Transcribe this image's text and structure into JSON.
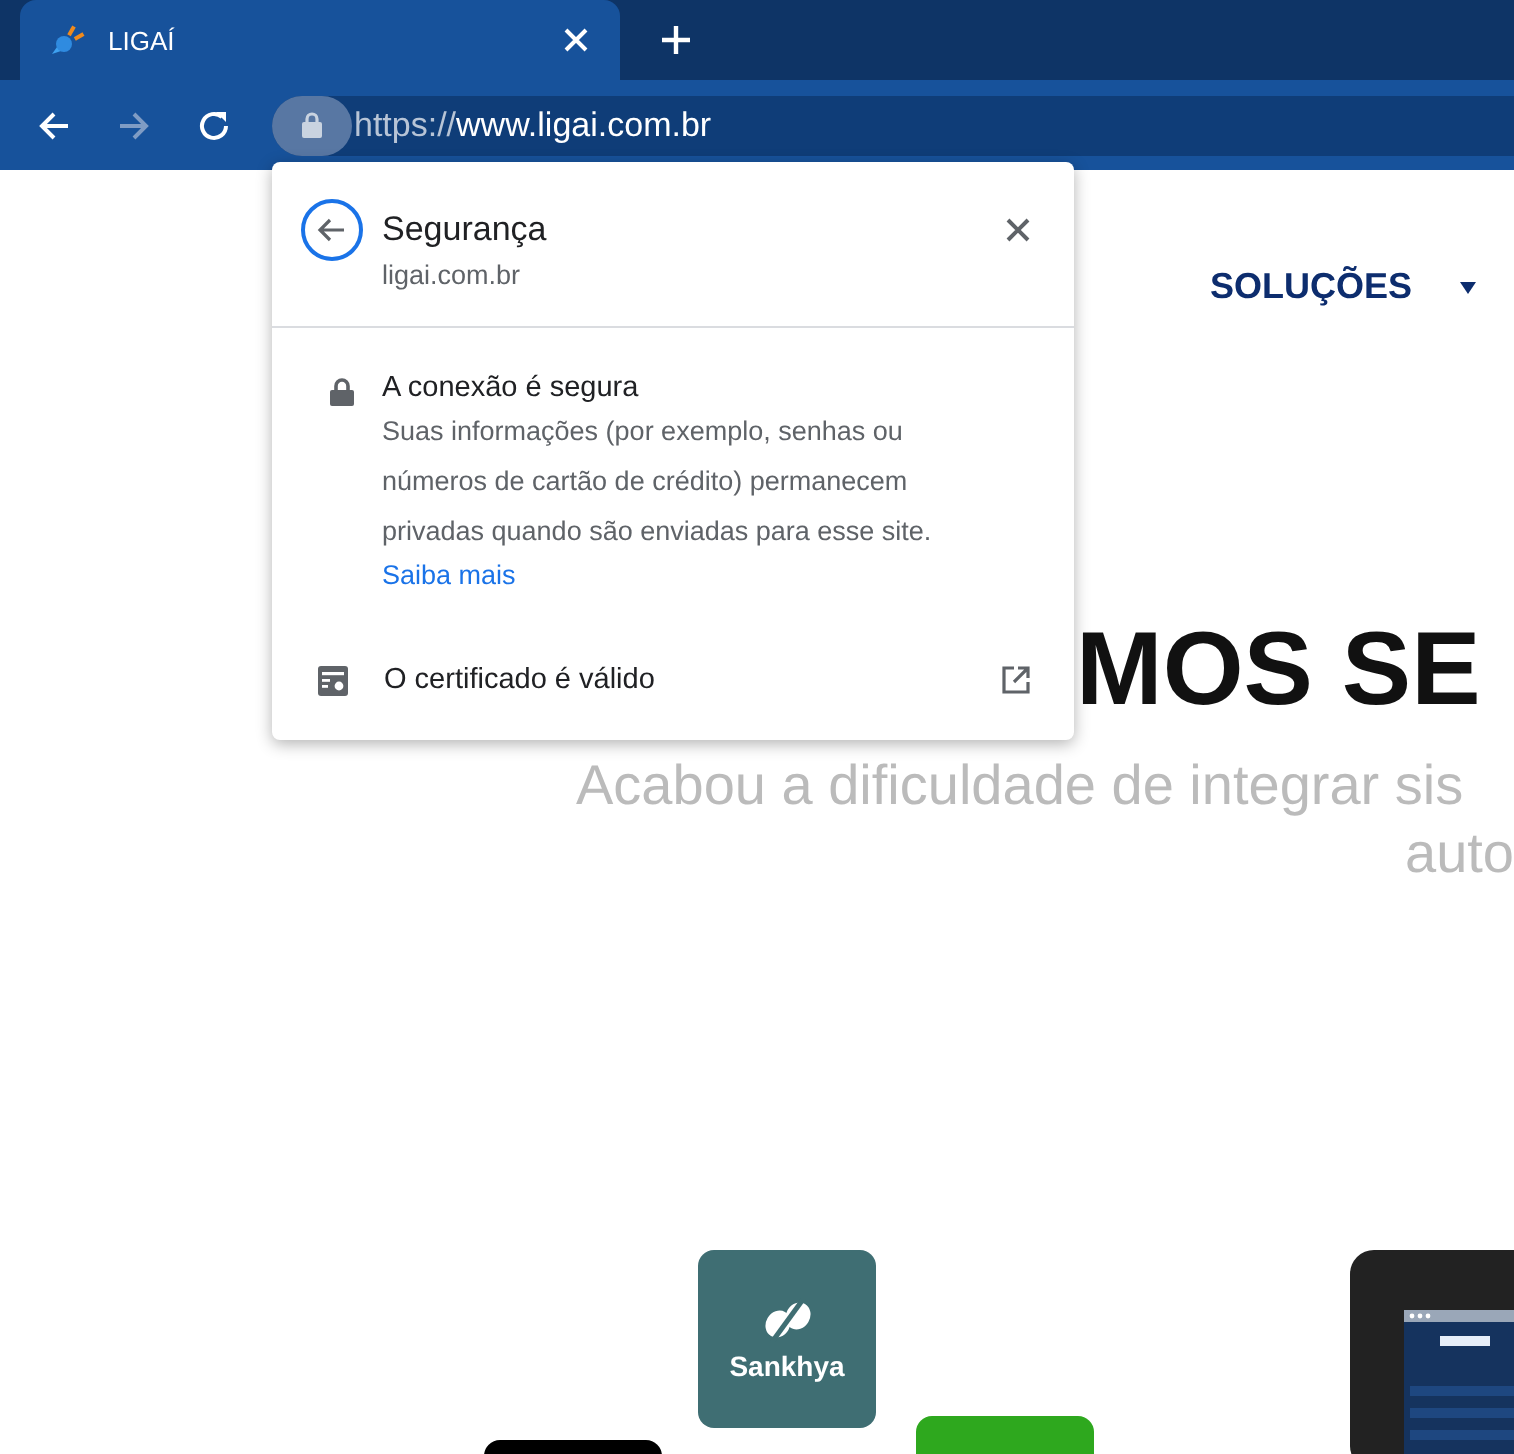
{
  "browser": {
    "tabs": [
      {
        "title": "LIGAÍ",
        "selected": true
      }
    ],
    "nav": {
      "back_enabled": true,
      "forward_enabled": false
    },
    "address_bar": {
      "scheme": "https://",
      "host": "www.ligai.com.br",
      "secure": true
    }
  },
  "security_popup": {
    "title": "Segurança",
    "site": "ligai.com.br",
    "sections": [
      {
        "kind": "connection",
        "title": "A conexão é segura",
        "body": "Suas informações (por exemplo, senhas ou números de cartão de crédito) permanecem privadas quando são enviadas para esse site.",
        "link": "Saiba mais"
      },
      {
        "kind": "certificate",
        "title": "O certificado é válido"
      }
    ]
  },
  "page": {
    "nav_items": [
      {
        "label": "SOLUÇÕES",
        "has_dropdown": true
      }
    ],
    "headline": "MOS SE",
    "subtitle_lines": [
      "Acabou a dificuldade de integrar sis",
      "auto"
    ],
    "partner_logos": [
      {
        "kind": "sankhya",
        "name": "Sankhya"
      },
      {
        "kind": "black"
      },
      {
        "kind": "green"
      }
    ],
    "device_mockup": {
      "kind": "picture"
    }
  }
}
